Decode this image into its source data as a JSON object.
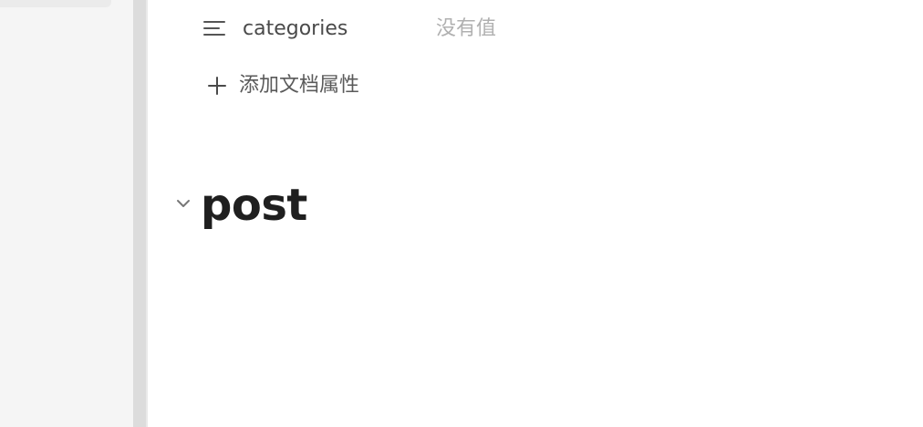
{
  "document": {
    "properties": [
      {
        "icon": "list-lines-icon",
        "name": "categories",
        "value_placeholder": "没有值"
      }
    ],
    "add_property_label": "添加文档属性",
    "heading": "post"
  },
  "colors": {
    "sidebar_bg": "#f5f5f5",
    "editor_bg": "#ffffff",
    "text_primary": "#1f1f1f",
    "text_muted": "#b0b0b0"
  }
}
